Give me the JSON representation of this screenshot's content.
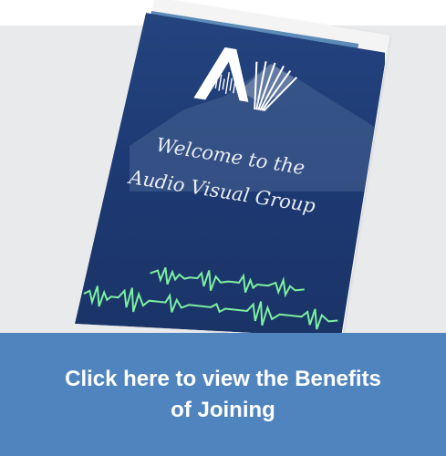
{
  "brochure": {
    "logo_letters": "AV",
    "headline_line1": "Welcome to the",
    "headline_line2": "Audio Visual Group",
    "colors": {
      "cover": "#1f3d78",
      "cover_dark": "#142d5c",
      "waveform": "#7df0a0"
    }
  },
  "cta": {
    "label_line1": "Click here to view the Benefits",
    "label_line2": "of Joining",
    "background": "#4f84bf"
  }
}
